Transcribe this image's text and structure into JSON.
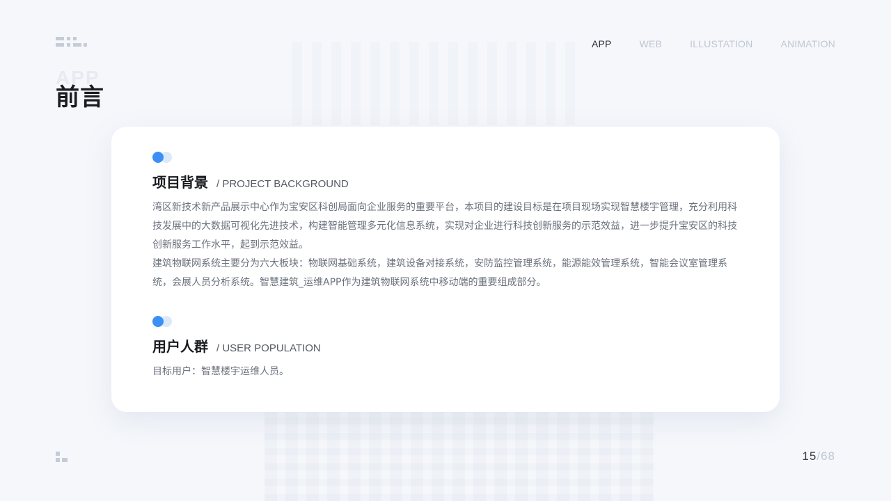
{
  "nav": {
    "items": [
      {
        "label": "APP",
        "active": true
      },
      {
        "label": "WEB",
        "active": false
      },
      {
        "label": "ILLUSTATION",
        "active": false
      },
      {
        "label": "ANIMATION",
        "active": false
      }
    ]
  },
  "header": {
    "ghost_title": "APP",
    "title": "前言"
  },
  "sections": [
    {
      "title": "项目背景",
      "subtitle": "/ PROJECT BACKGROUND",
      "paragraphs": [
        "湾区新技术新产品展示中心作为宝安区科创局面向企业服务的重要平台，本项目的建设目标是在项目现场实现智慧楼宇管理，充分利用科技发展中的大数据可视化先进技术，构建智能管理多元化信息系统，实现对企业进行科技创新服务的示范效益，进一步提升宝安区的科技创新服务工作水平，起到示范效益。",
        "建筑物联网系统主要分为六大板块：物联网基础系统，建筑设备对接系统，安防监控管理系统，能源能效管理系统，智能会议室管理系统，会展人员分析系统。智慧建筑_运维APP作为建筑物联网系统中移动端的重要组成部分。"
      ]
    },
    {
      "title": "用户人群",
      "subtitle": "/ USER POPULATION",
      "paragraphs": [
        "目标用户：智慧楼宇运维人员。"
      ]
    }
  ],
  "pager": {
    "current": "15",
    "separator": "/",
    "total": "68"
  },
  "colors": {
    "accent": "#3b8ff5",
    "accent_light": "#dbe9fb",
    "nav_inactive": "#c0c7d2",
    "title": "#1a1c20",
    "body_text": "#6b717c"
  },
  "icons": {
    "logo": "brand-grid-logo-icon",
    "footer": "brand-small-logo-icon",
    "section_marker": "dot-pair-icon"
  }
}
